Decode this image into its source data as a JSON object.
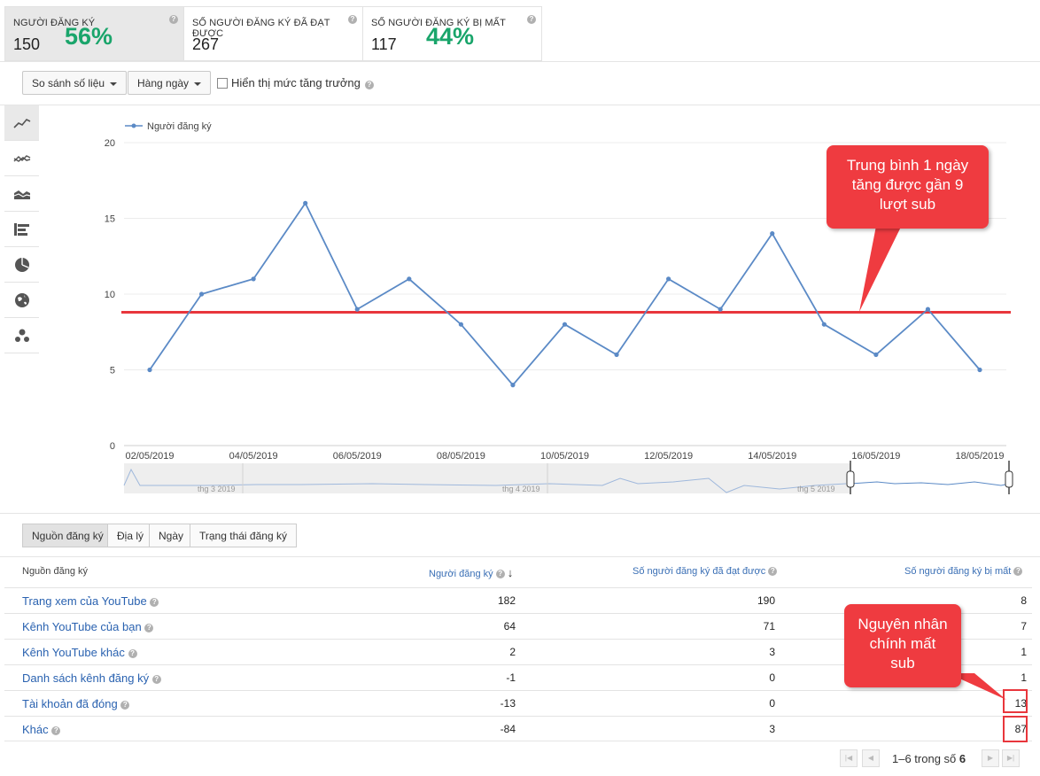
{
  "metrics": [
    {
      "label": "NGƯỜI ĐĂNG KÝ",
      "value": "150",
      "percent": "56%"
    },
    {
      "label": "SỐ NGƯỜI ĐĂNG KÝ ĐÃ ĐẠT ĐƯỢC",
      "value": "267"
    },
    {
      "label": "SỐ NGƯỜI ĐĂNG KÝ BỊ MẤT",
      "value": "117",
      "percent": "44%"
    }
  ],
  "controls": {
    "compare_label": "So sánh số liệu",
    "interval_label": "Hàng ngày",
    "growth_label": "Hiển thị mức tăng trưởng",
    "growth_checked": false
  },
  "chart_data": {
    "type": "line",
    "legend": "Người đăng ký",
    "x": [
      "02/05/2019",
      "03/05/2019",
      "04/05/2019",
      "05/05/2019",
      "06/05/2019",
      "07/05/2019",
      "08/05/2019",
      "09/05/2019",
      "10/05/2019",
      "11/05/2019",
      "12/05/2019",
      "13/05/2019",
      "14/05/2019",
      "15/05/2019",
      "16/05/2019",
      "17/05/2019",
      "18/05/2019"
    ],
    "series": [
      {
        "name": "Người đăng ký",
        "values": [
          5,
          10,
          11,
          16,
          9,
          11,
          8,
          4,
          8,
          6,
          11,
          9,
          14,
          8,
          6,
          9,
          5
        ]
      }
    ],
    "x_tick_labels": [
      "02/05/2019",
      "04/05/2019",
      "06/05/2019",
      "08/05/2019",
      "10/05/2019",
      "12/05/2019",
      "14/05/2019",
      "16/05/2019",
      "18/05/2019"
    ],
    "y_ticks": [
      0,
      5,
      10,
      15,
      20
    ],
    "ylim": [
      0,
      20
    ],
    "reference_line": 8.8,
    "line_color": "#5b8ac6",
    "reference_color": "#e8363c",
    "grid": true
  },
  "navigator": {
    "months": [
      "thg 3 2019",
      "thg 4 2019",
      "thg 5 2019"
    ]
  },
  "annotations": {
    "average": "Trung bình 1 ngày tăng được gần 9 lượt sub",
    "main_cause": "Nguyên nhân chính mất sub"
  },
  "tabs": [
    "Nguồn đăng ký",
    "Địa lý",
    "Ngày",
    "Trạng thái đăng ký"
  ],
  "table": {
    "headers": [
      "Nguồn đăng ký",
      "Người đăng ký",
      "Số người đăng ký đã đạt được",
      "Số người đăng ký bị mất"
    ],
    "rows": [
      {
        "name": "Trang xem của YouTube",
        "subs": "182",
        "gained": "190",
        "lost": "8"
      },
      {
        "name": "Kênh YouTube của bạn",
        "subs": "64",
        "gained": "71",
        "lost": "7"
      },
      {
        "name": "Kênh YouTube khác",
        "subs": "2",
        "gained": "3",
        "lost": "1"
      },
      {
        "name": "Danh sách kênh đăng ký",
        "subs": "-1",
        "gained": "0",
        "lost": "1"
      },
      {
        "name": "Tài khoản đã đóng",
        "subs": "-13",
        "gained": "0",
        "lost": "13"
      },
      {
        "name": "Khác",
        "subs": "-84",
        "gained": "3",
        "lost": "87"
      }
    ]
  },
  "pagination": {
    "range": "1–6 trong số",
    "total": "6"
  }
}
